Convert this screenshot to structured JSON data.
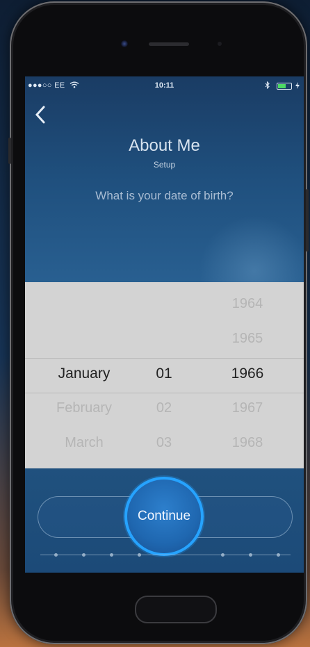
{
  "status_bar": {
    "carrier": "●●●○○ EE",
    "wifi": "wifi-icon",
    "time": "10:11",
    "bluetooth": "bluetooth-icon"
  },
  "header": {
    "back_label": "back",
    "title": "About Me",
    "subtitle": "Setup"
  },
  "question": "What is your date of birth?",
  "picker": {
    "months": [
      "January",
      "February",
      "March"
    ],
    "days": [
      "01",
      "02",
      "03"
    ],
    "years": [
      "1964",
      "1965",
      "1966",
      "1967",
      "1968"
    ],
    "selected": {
      "month": "January",
      "day": "01",
      "year": "1966"
    }
  },
  "continue_label": "Continue",
  "progress": {
    "steps": 10
  },
  "colors": {
    "accent": "#26a3ff",
    "picker_bg": "#d3d3d3",
    "screen_bg": "#1f4f7d"
  }
}
